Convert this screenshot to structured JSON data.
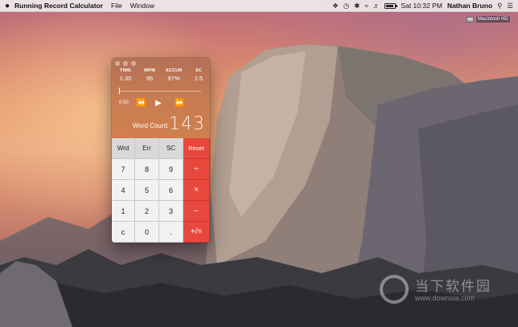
{
  "menubar": {
    "apple_icon": "apple-logo-icon",
    "app_name": "Running Record Calculator",
    "menus": [
      "File",
      "Window"
    ],
    "tray": {
      "clock": "Sat 10:32 PM",
      "user": "Nathan Bruno",
      "battery_level": 0.9
    }
  },
  "desktop": {
    "hd_label": "Macintosh HD"
  },
  "calculator": {
    "stats": [
      {
        "label": "TIME",
        "value": "1:30"
      },
      {
        "label": "WPM",
        "value": "95"
      },
      {
        "label": "ACCUR",
        "value": "97%"
      },
      {
        "label": "SC",
        "value": "1:5"
      }
    ],
    "playback": {
      "elapsed": "0:00",
      "rewind_icon": "rewind-icon",
      "play_icon": "play-icon",
      "forward_icon": "fast-forward-icon",
      "progress": 0.0
    },
    "word_count": {
      "label": "Word Count:",
      "value": "143"
    },
    "keypad": [
      {
        "label": "Wrd",
        "kind": "func",
        "name": "wrd-key"
      },
      {
        "label": "Err",
        "kind": "func",
        "name": "err-key"
      },
      {
        "label": "SC",
        "kind": "func",
        "name": "sc-key"
      },
      {
        "label": "Reset",
        "kind": "op reset",
        "name": "reset-key"
      },
      {
        "label": "7",
        "kind": "num",
        "name": "key-7"
      },
      {
        "label": "8",
        "kind": "num",
        "name": "key-8"
      },
      {
        "label": "9",
        "kind": "num",
        "name": "key-9"
      },
      {
        "label": "÷",
        "kind": "op",
        "name": "divide-key"
      },
      {
        "label": "4",
        "kind": "num",
        "name": "key-4"
      },
      {
        "label": "5",
        "kind": "num",
        "name": "key-5"
      },
      {
        "label": "6",
        "kind": "num",
        "name": "key-6"
      },
      {
        "label": "×",
        "kind": "op",
        "name": "multiply-key"
      },
      {
        "label": "1",
        "kind": "num",
        "name": "key-1"
      },
      {
        "label": "2",
        "kind": "num",
        "name": "key-2"
      },
      {
        "label": "3",
        "kind": "num",
        "name": "key-3"
      },
      {
        "label": "–",
        "kind": "op",
        "name": "subtract-key"
      },
      {
        "label": "c",
        "kind": "num",
        "name": "clear-key"
      },
      {
        "label": "0",
        "kind": "num",
        "name": "key-0"
      },
      {
        "label": ".",
        "kind": "num",
        "name": "decimal-key"
      },
      {
        "label": "+/=",
        "kind": "op",
        "name": "add-equals-key"
      }
    ]
  },
  "watermark": {
    "text": "当下软件园",
    "url": "www.downxia.com"
  },
  "colors": {
    "accent_red": "#e8483b",
    "window_orange": "#c4784e"
  }
}
